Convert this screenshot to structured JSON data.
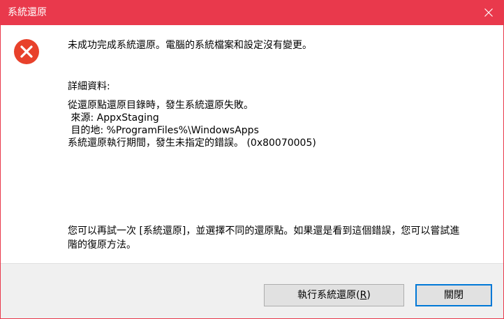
{
  "window": {
    "title": "系統還原",
    "accent_color": "#e9394c"
  },
  "icons": {
    "close": "close-icon",
    "error": "error-icon"
  },
  "message": {
    "headline": "未成功完成系統還原。電腦的系統檔案和設定沒有變更。",
    "details_label": "詳細資料:",
    "detail_line1": "從還原點還原目錄時，發生系統還原失敗。",
    "detail_source": " 來源: AppxStaging",
    "detail_destination": " 目的地: %ProgramFiles%\\WindowsApps",
    "detail_error": "系統還原執行期間，發生未指定的錯誤。 (0x80070005)",
    "suggestion_line1": "您可以再試一次 [系統還原]，並選擇不同的還原點。如果還是看到這個錯誤，您可以嘗試進",
    "suggestion_line2": "階的復原方法。"
  },
  "buttons": {
    "restore_label_prefix": "執行系統還原(",
    "restore_label_key": "R",
    "restore_label_suffix": ")",
    "close_label": "關閉"
  }
}
